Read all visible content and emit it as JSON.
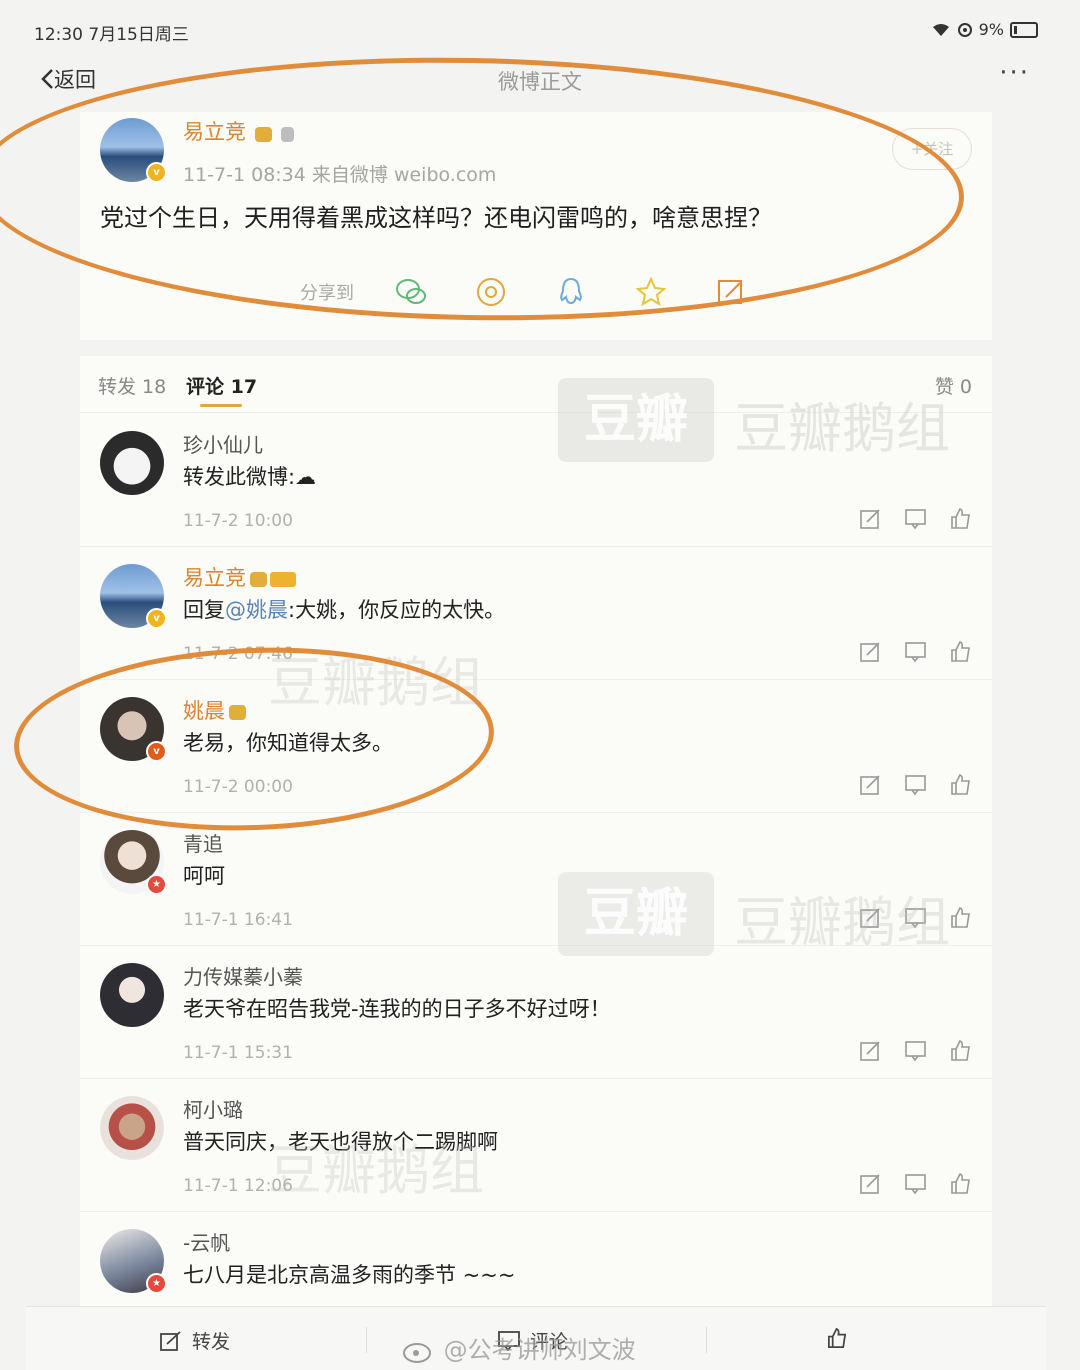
{
  "status_bar": {
    "time": "12:30",
    "date": "7月15日周三",
    "battery": "9%"
  },
  "nav": {
    "back": "返回",
    "title": "微博正文",
    "more": "···"
  },
  "post": {
    "author": "易立竞",
    "meta": "11-7-1 08:34  来自微博 weibo.com",
    "text": "党过个生日，天用得着黑成这样吗？还电闪雷鸣的，啥意思捏？",
    "follow": "+关注",
    "share_label": "分享到",
    "share_icons": [
      "wechat-icon",
      "moments-icon",
      "qq-icon",
      "favorite-star-icon",
      "edit-icon"
    ]
  },
  "tabs": {
    "repost": "转发 18",
    "comments": "评论 17",
    "likes": "赞 0"
  },
  "comments": [
    {
      "name": "珍小仙儿",
      "text": "转发此微博:☁",
      "time": "11-7-2 10:00",
      "avatar": "panda"
    },
    {
      "name": "易立竞",
      "text_prefix": "回复",
      "mention": "@姚晨",
      "text": ":大姚，你反应的太快。",
      "time": "11-7-2 07:46",
      "avatar": "sky"
    },
    {
      "name": "姚晨",
      "text": "老易，你知道得太多。",
      "time": "11-7-2 00:00",
      "avatar": "woman"
    },
    {
      "name": "青追",
      "text": "呵呵",
      "time": "11-7-1 16:41",
      "avatar": "girl"
    },
    {
      "name": "力传媒蓁小蓁",
      "text": "老天爷在昭告我党-连我的的日子多不好过呀！",
      "time": "11-7-1 15:31",
      "avatar": "dark"
    },
    {
      "name": "柯小璐",
      "text": "普天同庆，老天也得放个二踢脚啊",
      "time": "11-7-1 12:06",
      "avatar": "red"
    },
    {
      "name": "-云帆",
      "text": "七八月是北京高温多雨的季节 ~~~",
      "time": "",
      "avatar": "cloud"
    }
  ],
  "bottom_bar": {
    "repost": "转发",
    "comment": "评论",
    "like": ""
  },
  "watermarks": {
    "group": "豆瓣鹅组",
    "logo": "豆瓣",
    "credit": "@公考讲师刘文波"
  },
  "colors": {
    "accent_orange": "#e08c3b",
    "username_orange": "#d9862f",
    "mention_blue": "#5a83b8"
  }
}
